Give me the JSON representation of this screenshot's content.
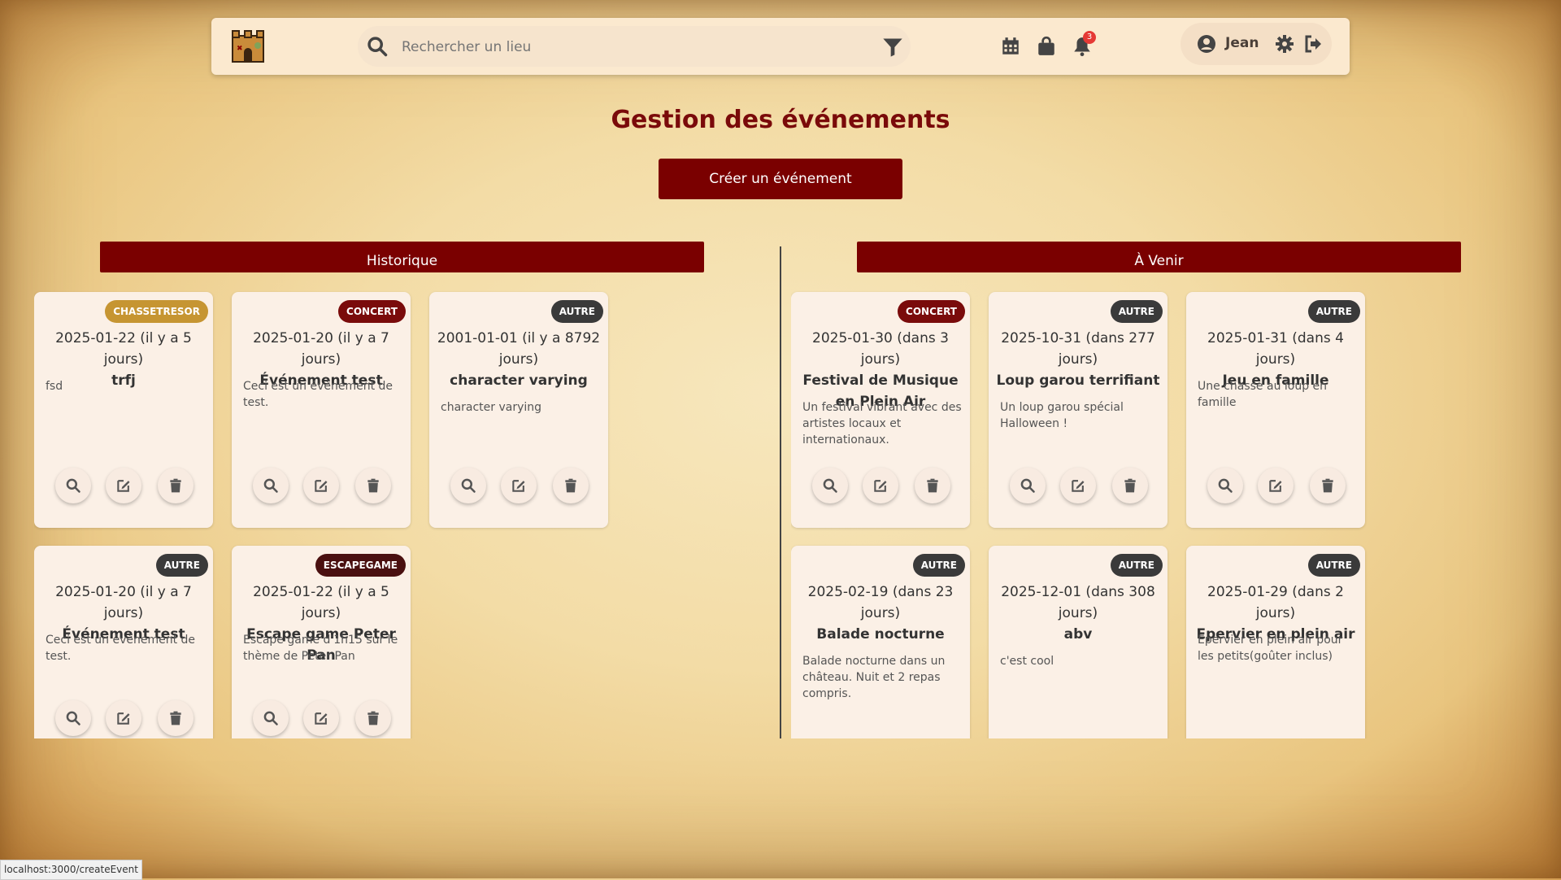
{
  "header": {
    "search_placeholder": "Rechercher un lieu",
    "notifications_count": "3",
    "user_name": "Jean"
  },
  "main": {
    "title": "Gestion des événements",
    "create_button": "Créer un événement",
    "sections": {
      "history": "Historique",
      "upcoming": "À Venir"
    }
  },
  "history_cards": [
    {
      "tag": "CHASSETRESOR",
      "date": "2025-01-22 (il y a 5 jours)",
      "title": "trfj",
      "description": "fsd"
    },
    {
      "tag": "CONCERT",
      "date": "2025-01-20 (il y a 7 jours)",
      "title": "Événement test",
      "description": "Ceci est un événement de test."
    },
    {
      "tag": "AUTRE",
      "date": "2001-01-01 (il y a 8792 jours)",
      "title": "character varying",
      "description": "character varying"
    },
    {
      "tag": "AUTRE",
      "date": "2025-01-20 (il y a 7 jours)",
      "title": "Événement test",
      "description": "Ceci est un événement de test."
    },
    {
      "tag": "ESCAPEGAME",
      "date": "2025-01-22 (il y a 5 jours)",
      "title": "Escape game Peter Pan",
      "description": "Escape game d'1h15 sur le thème de Peter Pan"
    }
  ],
  "upcoming_cards": [
    {
      "tag": "CONCERT",
      "date": "2025-01-30 (dans 3 jours)",
      "title": "Festival de Musique en Plein Air",
      "description": "Un festival vibrant avec des artistes locaux et internationaux."
    },
    {
      "tag": "AUTRE",
      "date": "2025-10-31 (dans 277 jours)",
      "title": "Loup garou terrifiant",
      "description": "Un loup garou spécial Halloween !"
    },
    {
      "tag": "AUTRE",
      "date": "2025-01-31 (dans 4 jours)",
      "title": "Jeu en famille",
      "description": "Une chasse au loup en famille"
    },
    {
      "tag": "AUTRE",
      "date": "2025-02-19 (dans 23 jours)",
      "title": "Balade nocturne",
      "description": "Balade nocturne dans un château. Nuit et 2 repas compris."
    },
    {
      "tag": "AUTRE",
      "date": "2025-12-01 (dans 308 jours)",
      "title": "abv",
      "description": "c'est cool"
    },
    {
      "tag": "AUTRE",
      "date": "2025-01-29 (dans 2 jours)",
      "title": "Epervier en plein air",
      "description": "Epervier en plein air pour les petits(goûter inclus)"
    }
  ],
  "status_bar": "localhost:3000/createEvent",
  "colors": {
    "accent": "#7a0000",
    "tag_autre": "#3a3a3a",
    "tag_concert": "#7a0b0b",
    "tag_chasse": "#c69532",
    "tag_escape": "#4a1010"
  }
}
